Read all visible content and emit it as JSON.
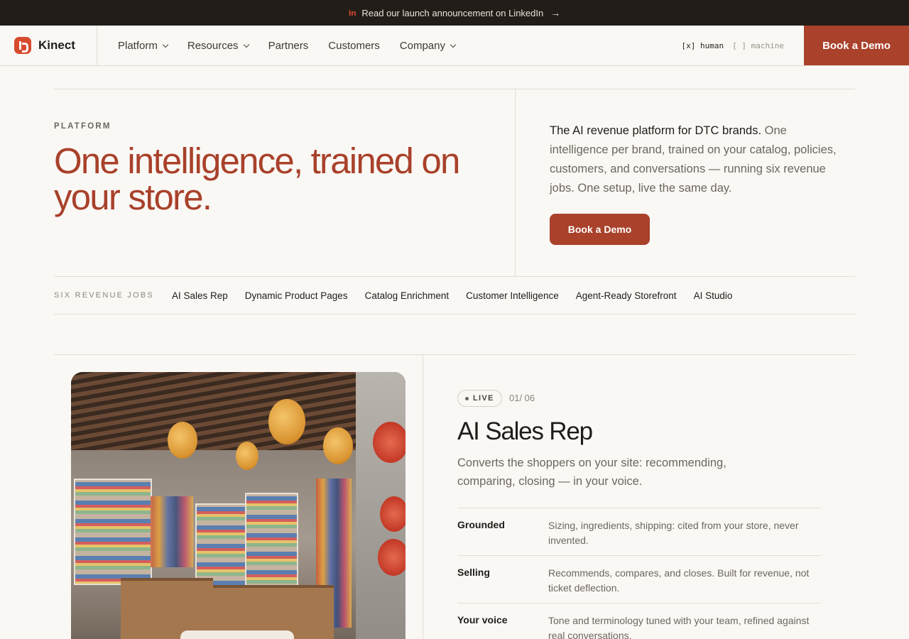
{
  "announcement": {
    "icon": "linkedin-icon",
    "icon_glyph": "in",
    "text": "Read our launch announcement on LinkedIn",
    "arrow": "→"
  },
  "nav": {
    "brand": "Kinect",
    "items": [
      {
        "label": "Platform",
        "dropdown": true
      },
      {
        "label": "Resources",
        "dropdown": true
      },
      {
        "label": "Partners",
        "dropdown": false
      },
      {
        "label": "Customers",
        "dropdown": false
      },
      {
        "label": "Company",
        "dropdown": true
      }
    ],
    "mode_human": "[x] human",
    "mode_machine": "[ ] machine",
    "cta": "Book a Demo"
  },
  "hero": {
    "eyebrow": "PLATFORM",
    "title": "One intelligence, trained on your store.",
    "desc_bold": "The AI revenue platform for DTC brands.",
    "desc_rest": " One intelligence per brand, trained on your catalog, policies, customers, and conversations — running six revenue jobs. One setup, live the same day.",
    "cta": "Book a Demo"
  },
  "jobs": {
    "label": "SIX REVENUE JOBS",
    "items": [
      "AI Sales Rep",
      "Dynamic Product Pages",
      "Catalog Enrichment",
      "Customer Intelligence",
      "Agent-Ready Storefront",
      "AI Studio"
    ]
  },
  "feature": {
    "status": "LIVE",
    "counter": "01/ 06",
    "title": "AI Sales Rep",
    "subtitle": "Converts the shoppers on your site: recommending, comparing, closing — in your voice.",
    "specs": [
      {
        "key": "Grounded",
        "value": "Sizing, ingredients, shipping: cited from your store, never invented."
      },
      {
        "key": "Selling",
        "value": "Recommends, compares, and closes. Built for revenue, not ticket deflection."
      },
      {
        "key": "Your voice",
        "value": "Tone and terminology tuned with your team, refined against real conversations."
      }
    ]
  },
  "colors": {
    "accent": "#a9412b",
    "top_bar": "#221d18",
    "background": "#faf8f4"
  }
}
